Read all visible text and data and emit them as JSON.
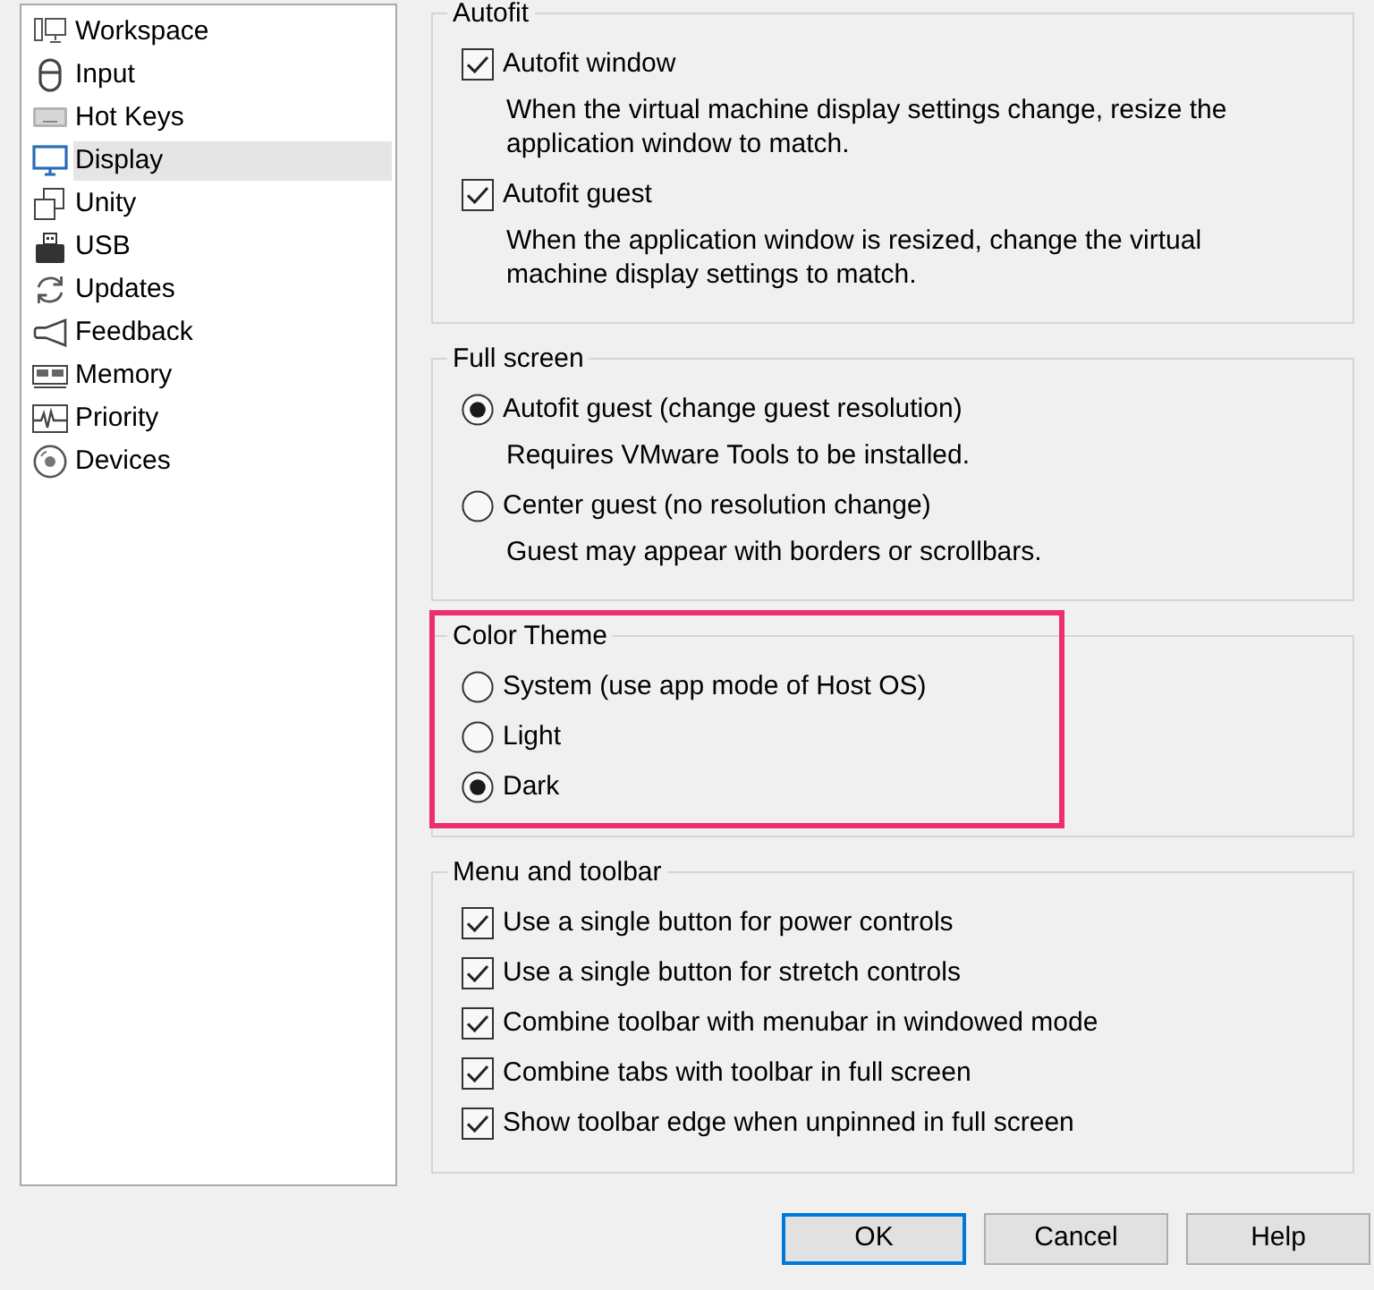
{
  "sidebar": {
    "items": [
      {
        "label": "Workspace",
        "selected": false
      },
      {
        "label": "Input",
        "selected": false
      },
      {
        "label": "Hot Keys",
        "selected": false
      },
      {
        "label": "Display",
        "selected": true
      },
      {
        "label": "Unity",
        "selected": false
      },
      {
        "label": "USB",
        "selected": false
      },
      {
        "label": "Updates",
        "selected": false
      },
      {
        "label": "Feedback",
        "selected": false
      },
      {
        "label": "Memory",
        "selected": false
      },
      {
        "label": "Priority",
        "selected": false
      },
      {
        "label": "Devices",
        "selected": false
      }
    ]
  },
  "groups": [
    {
      "title": "Autofit",
      "highlighted": false,
      "options": [
        {
          "kind": "checkbox",
          "label": "Autofit window",
          "checked": true,
          "description": "When the virtual machine display settings change, resize the application window to match."
        },
        {
          "kind": "checkbox",
          "label": "Autofit guest",
          "checked": true,
          "description": "When the application window is resized, change the virtual machine display settings to match."
        }
      ]
    },
    {
      "title": "Full screen",
      "highlighted": false,
      "options": [
        {
          "kind": "radio",
          "label": "Autofit guest (change guest resolution)",
          "selected": true,
          "description": "Requires VMware Tools to be installed."
        },
        {
          "kind": "radio",
          "label": "Center guest (no resolution change)",
          "selected": false,
          "description": "Guest may appear with borders or scrollbars."
        }
      ]
    },
    {
      "title": "Color Theme",
      "highlighted": true,
      "options": [
        {
          "kind": "radio",
          "label": "System (use app mode of Host OS)",
          "selected": false
        },
        {
          "kind": "radio",
          "label": "Light",
          "selected": false
        },
        {
          "kind": "radio",
          "label": "Dark",
          "selected": true
        }
      ]
    },
    {
      "title": "Menu and toolbar",
      "highlighted": false,
      "options": [
        {
          "kind": "checkbox",
          "label": "Use a single button for power controls",
          "checked": true
        },
        {
          "kind": "checkbox",
          "label": "Use a single button for stretch controls",
          "checked": true
        },
        {
          "kind": "checkbox",
          "label": "Combine toolbar with menubar in windowed mode",
          "checked": true
        },
        {
          "kind": "checkbox",
          "label": "Combine tabs with toolbar in full screen",
          "checked": true
        },
        {
          "kind": "checkbox",
          "label": "Show toolbar edge when unpinned in full screen",
          "checked": true
        }
      ]
    }
  ],
  "buttons": [
    {
      "label": "OK",
      "default": true
    },
    {
      "label": "Cancel",
      "default": false
    },
    {
      "label": "Help",
      "default": false
    }
  ]
}
